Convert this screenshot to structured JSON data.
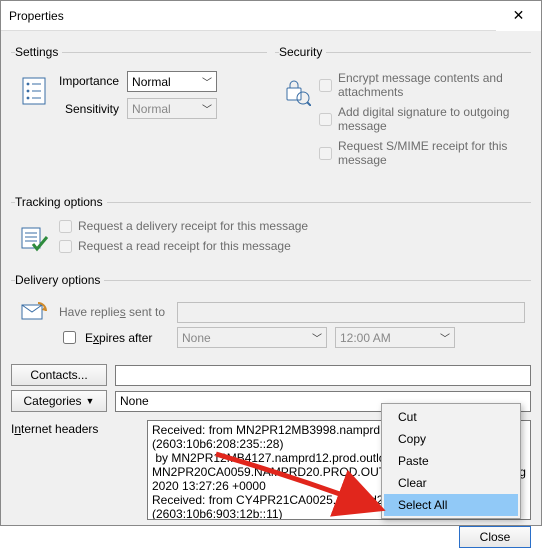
{
  "window": {
    "title": "Properties"
  },
  "settings": {
    "legend": "Settings",
    "importance_label": "Importance",
    "importance_value": "Normal",
    "sensitivity_label": "Sensitivity",
    "sensitivity_value": "Normal"
  },
  "security": {
    "legend": "Security",
    "encrypt_label": "Encrypt message contents and attachments",
    "sign_label": "Add digital signature to outgoing message",
    "smime_label": "Request S/MIME receipt for this message"
  },
  "tracking": {
    "legend": "Tracking options",
    "delivery_receipt_label": "Request a delivery receipt for this message",
    "read_receipt_label": "Request a read receipt for this message"
  },
  "delivery": {
    "legend": "Delivery options",
    "have_replies_label": "Have replies sent to",
    "have_replies_value": "",
    "expires_after_label": "Expires after",
    "expires_date_value": "None",
    "expires_time_value": "12:00 AM"
  },
  "buttons": {
    "contacts": "Contacts...",
    "categories": "Categories",
    "close": "Close"
  },
  "categories_value": "None",
  "internet_headers": {
    "label": "Internet headers",
    "text": "Received: from MN2PR12MB3998.namprd12.prod.outlook.com (2603:10b6:208:235::28)\n by MN2PR12MB4127.namprd12.prod.outlook.com with HTTPS via MN2PR20CA0059.NAMPRD20.PROD.OUTLOOK.COM; Wed, 26 Aug 2020 13:27:26 +0000\nReceived: from CY4PR21CA0025.namprd21.prod (2603:10b6:903:12b::11)"
  },
  "context_menu": {
    "items": [
      "Cut",
      "Copy",
      "Paste",
      "Clear",
      "Select All"
    ],
    "highlight_index": 4
  }
}
